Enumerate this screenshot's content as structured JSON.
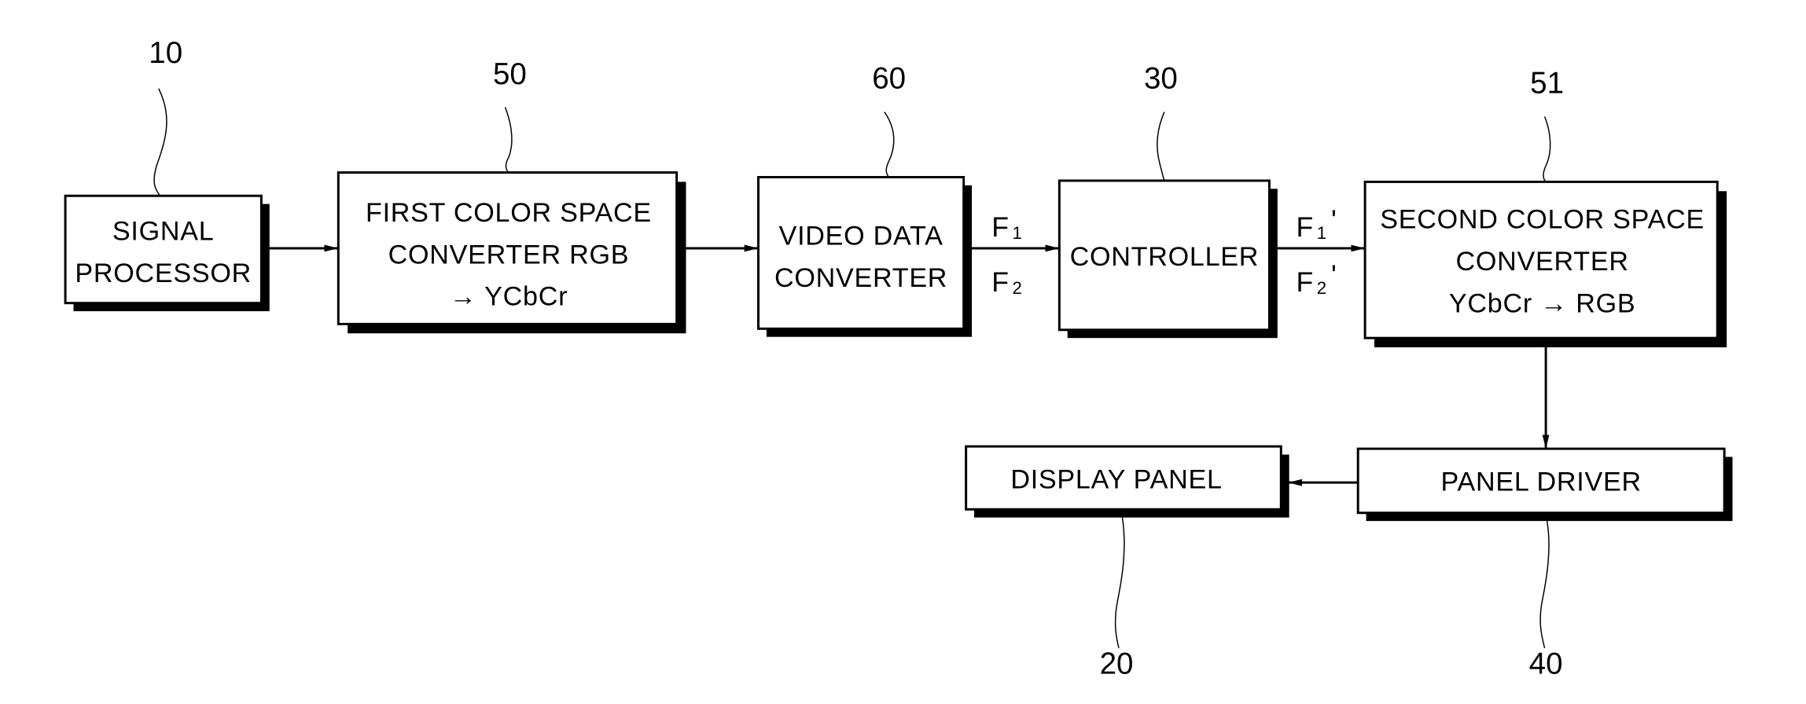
{
  "figure": {
    "blocks": {
      "signal_processor": {
        "ref": "10",
        "lines": [
          "SIGNAL",
          "PROCESSOR"
        ]
      },
      "first_converter": {
        "ref": "50",
        "lines": [
          "FIRST COLOR SPACE",
          "CONVERTER RGB",
          "→ YCbCr"
        ]
      },
      "video_converter": {
        "ref": "60",
        "lines": [
          "VIDEO DATA",
          "CONVERTER"
        ]
      },
      "controller": {
        "ref": "30",
        "lines": [
          "CONTROLLER"
        ]
      },
      "second_converter": {
        "ref": "51",
        "lines": [
          "SECOND COLOR SPACE",
          "CONVERTER",
          "YCbCr → RGB"
        ]
      },
      "panel_driver": {
        "ref": "40",
        "lines": [
          "PANEL DRIVER"
        ]
      },
      "display_panel": {
        "ref": "20",
        "lines": [
          "DISPLAY PANEL"
        ]
      }
    },
    "signals": {
      "video_to_controller": {
        "top": {
          "base": "F",
          "sub": "1",
          "prime": ""
        },
        "bottom": {
          "base": "F",
          "sub": "2",
          "prime": ""
        }
      },
      "controller_to_second": {
        "top": {
          "base": "F",
          "sub": "1",
          "prime": "'"
        },
        "bottom": {
          "base": "F",
          "sub": "2",
          "prime": "'"
        }
      }
    },
    "connections": [
      {
        "from": "signal_processor",
        "to": "first_converter"
      },
      {
        "from": "first_converter",
        "to": "video_converter"
      },
      {
        "from": "video_converter",
        "to": "controller"
      },
      {
        "from": "controller",
        "to": "second_converter"
      },
      {
        "from": "second_converter",
        "to": "panel_driver"
      },
      {
        "from": "panel_driver",
        "to": "display_panel"
      }
    ]
  }
}
